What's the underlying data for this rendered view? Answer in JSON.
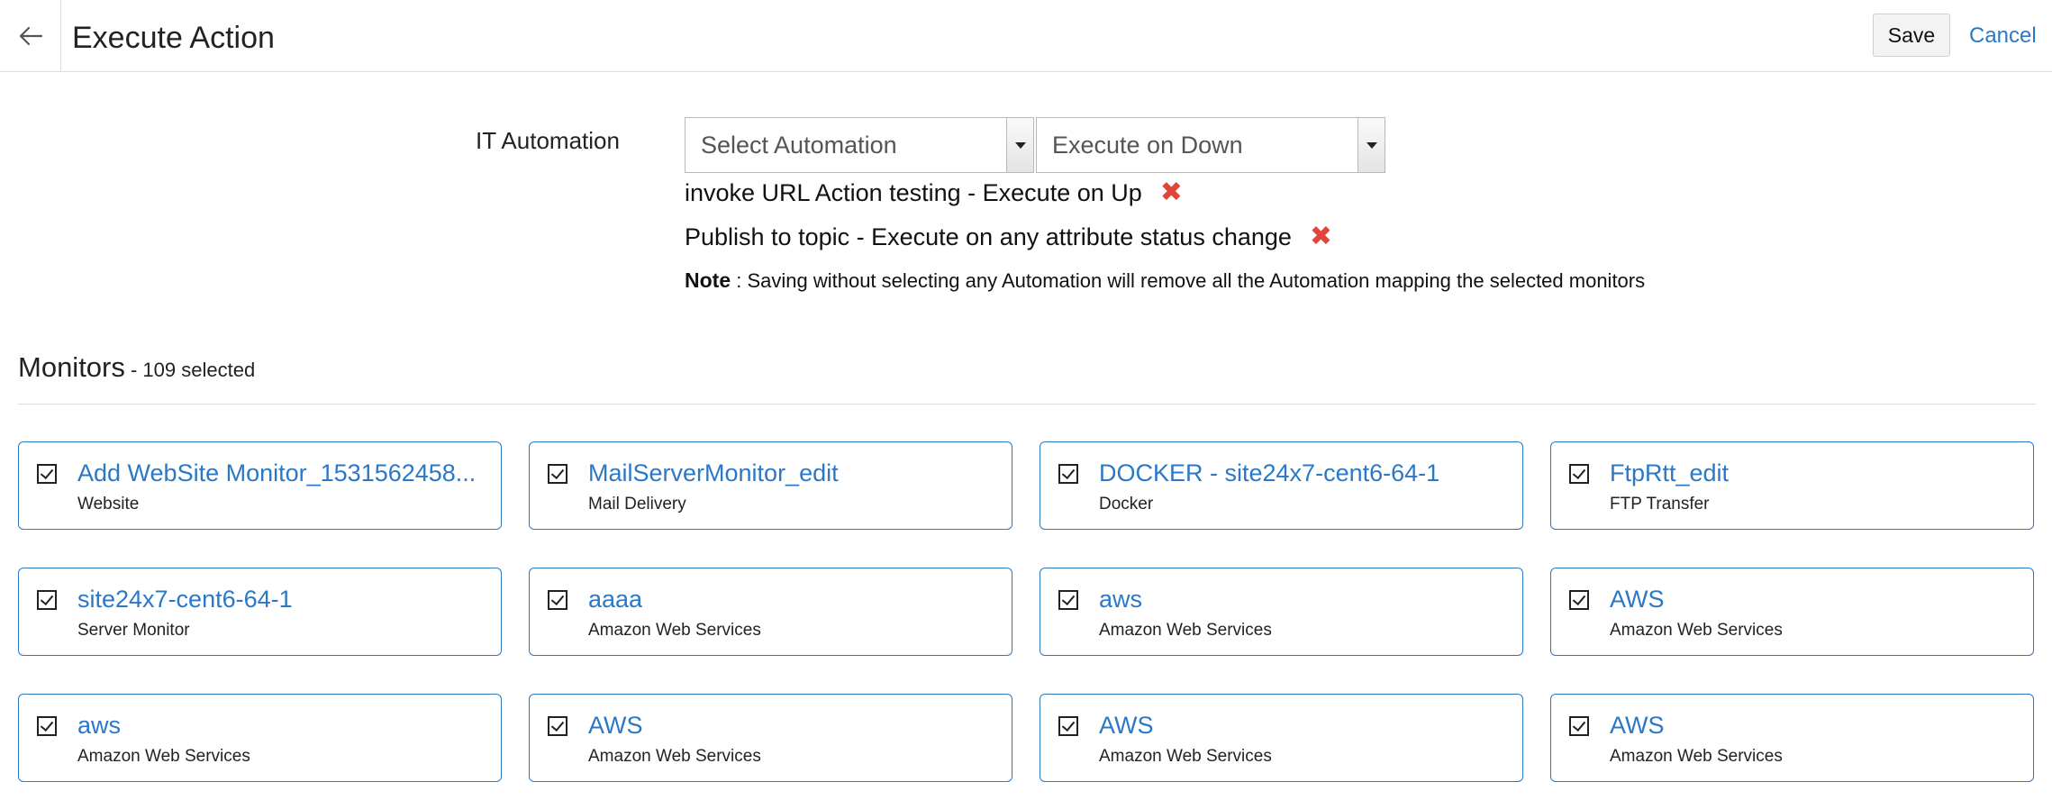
{
  "header": {
    "title": "Execute Action",
    "save_label": "Save",
    "cancel_label": "Cancel",
    "back_icon": "arrow-left-icon"
  },
  "automation": {
    "label": "IT Automation",
    "select_automation": "Select Automation",
    "select_condition": "Execute on Down",
    "mappings": [
      "invoke URL Action testing - Execute on Up",
      "Publish to topic - Execute on any attribute status change"
    ],
    "note_label": "Note",
    "note_text": " : Saving without selecting any Automation will remove all the Automation mapping the selected monitors"
  },
  "monitors": {
    "title": "Monitors",
    "count_text": " - 109 selected",
    "items": [
      {
        "name": "Add WebSite Monitor_1531562458...",
        "type": "Website",
        "checked": true
      },
      {
        "name": "MailServerMonitor_edit",
        "type": "Mail Delivery",
        "checked": true
      },
      {
        "name": "DOCKER - site24x7-cent6-64-1",
        "type": "Docker",
        "checked": true
      },
      {
        "name": "FtpRtt_edit",
        "type": "FTP Transfer",
        "checked": true
      },
      {
        "name": "site24x7-cent6-64-1",
        "type": "Server Monitor",
        "checked": true
      },
      {
        "name": "aaaa",
        "type": "Amazon Web Services",
        "checked": true
      },
      {
        "name": "aws",
        "type": "Amazon Web Services",
        "checked": true
      },
      {
        "name": "AWS",
        "type": "Amazon Web Services",
        "checked": true
      },
      {
        "name": "aws",
        "type": "Amazon Web Services",
        "checked": true
      },
      {
        "name": "AWS",
        "type": "Amazon Web Services",
        "checked": true
      },
      {
        "name": "AWS",
        "type": "Amazon Web Services",
        "checked": true
      },
      {
        "name": "AWS",
        "type": "Amazon Web Services",
        "checked": true
      }
    ]
  },
  "colors": {
    "link": "#2b78c6",
    "remove": "#e0443a",
    "card_border": "#2b78c6"
  }
}
